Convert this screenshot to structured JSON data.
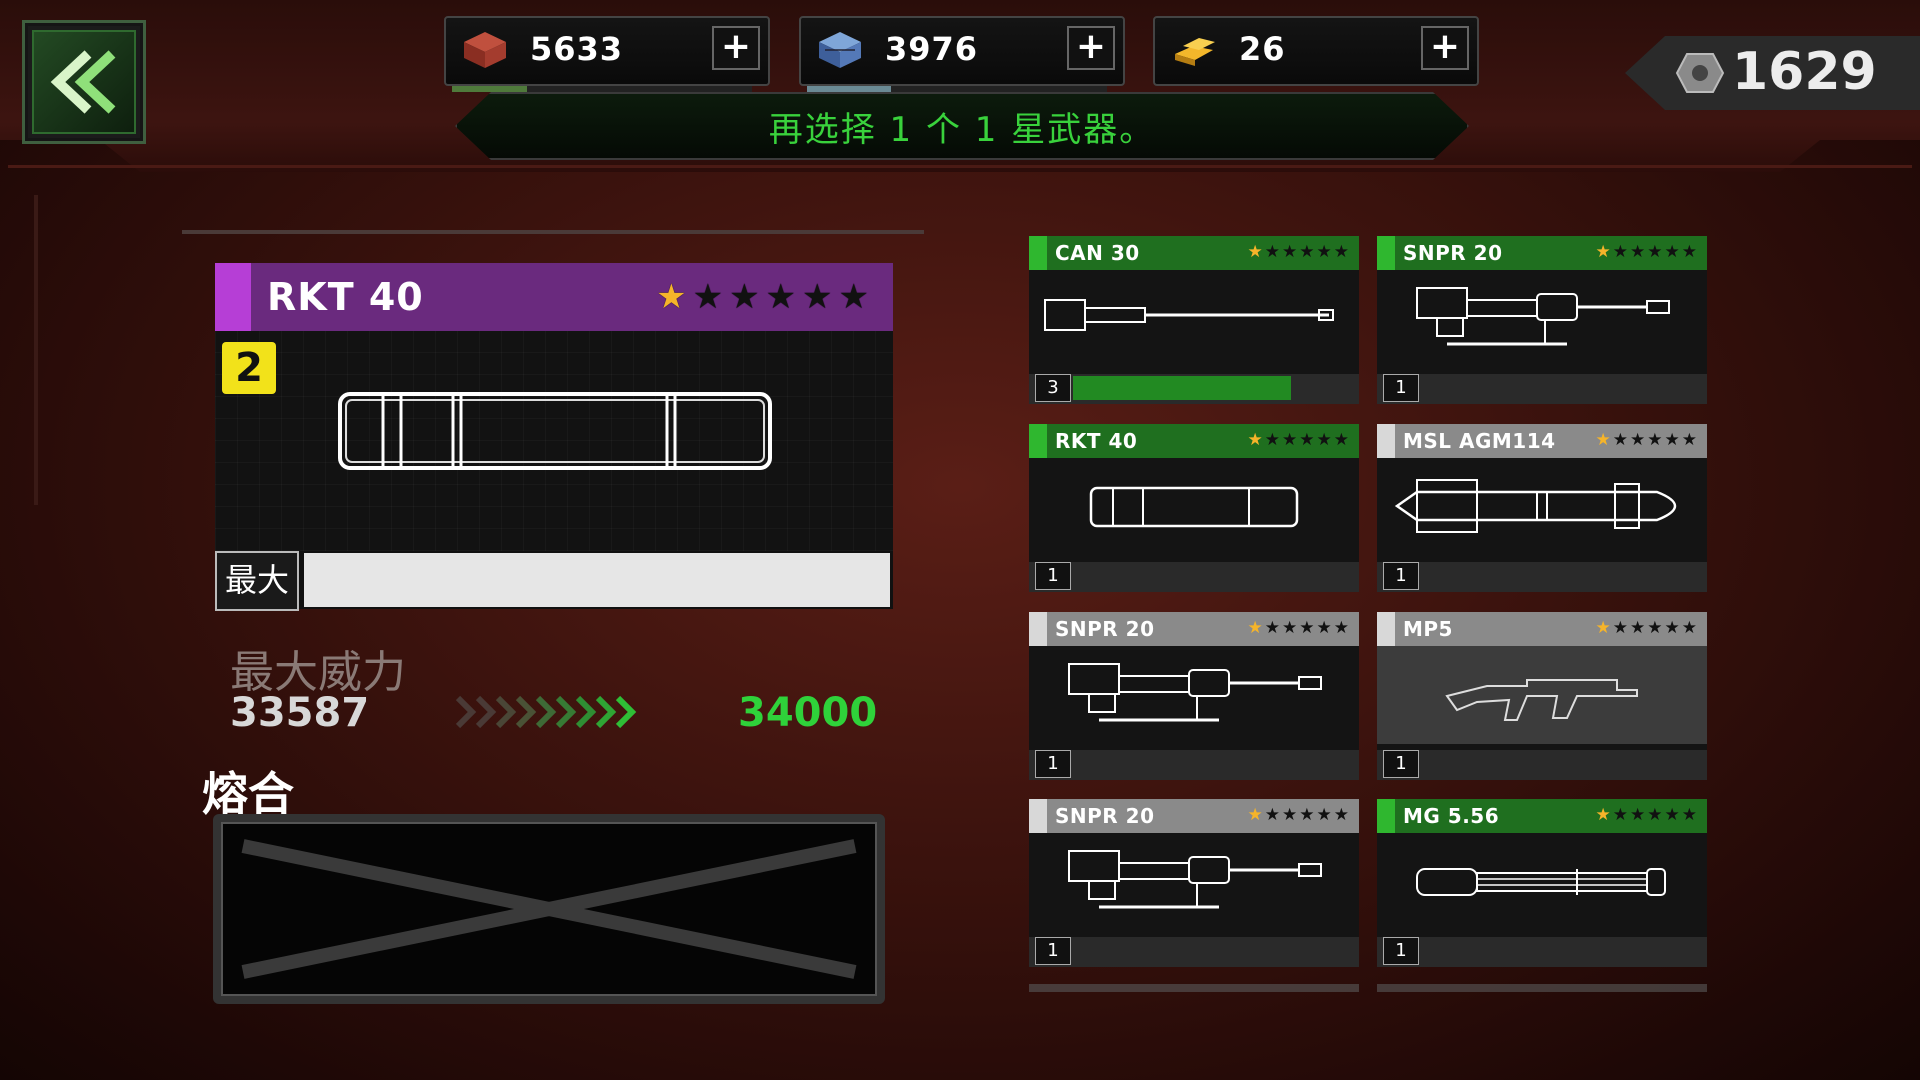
{
  "header": {
    "resources": [
      {
        "name": "red-crate",
        "value": "5633",
        "plus": "+",
        "fill_percent": 25,
        "bar_color": "#4f7a3b"
      },
      {
        "name": "blue-crate",
        "value": "3976",
        "plus": "+",
        "fill_percent": 28,
        "bar_color": "#6a8a94"
      },
      {
        "name": "gold-bars",
        "value": "26",
        "plus": "+",
        "fill_percent": 0,
        "bar_color": "#4f7a3b"
      }
    ],
    "gems": {
      "value": "1629",
      "icon": "hex-nut-icon"
    },
    "banner": "再选择 1 个 1 星武器。"
  },
  "selected": {
    "name": "RKT 40",
    "stars_total": 6,
    "stars_filled": 1,
    "level": "2",
    "max_label": "最大",
    "max_fill_percent": 100,
    "power_label": "最大威力",
    "power_current": "33587",
    "power_next": "34000"
  },
  "fuse": {
    "label": "熔合"
  },
  "weapons": [
    {
      "name": "CAN 30",
      "tier_color": "#2fb72f",
      "head_bg": "#1f6f1f",
      "stars_filled": 1,
      "count": "3",
      "progress_percent": 79,
      "icon": "cannon-icon"
    },
    {
      "name": "SNPR 20",
      "tier_color": "#2fb72f",
      "head_bg": "#1f6f1f",
      "stars_filled": 1,
      "count": "1",
      "progress_percent": 0,
      "icon": "sniper-icon"
    },
    {
      "name": "RKT 40",
      "tier_color": "#2fb72f",
      "head_bg": "#1f6f1f",
      "stars_filled": 1,
      "count": "1",
      "progress_percent": 0,
      "icon": "rocket-pod-icon"
    },
    {
      "name": "MSL AGM114",
      "tier_color": "#d8d8d8",
      "head_bg": "#8a8a8a",
      "stars_filled": 1,
      "count": "1",
      "progress_percent": 0,
      "icon": "missile-icon"
    },
    {
      "name": "SNPR 20",
      "tier_color": "#d8d8d8",
      "head_bg": "#8a8a8a",
      "stars_filled": 1,
      "count": "1",
      "progress_percent": 0,
      "icon": "sniper-icon"
    },
    {
      "name": "MP5",
      "tier_color": "#d8d8d8",
      "head_bg": "#8a8a8a",
      "stars_filled": 1,
      "count": "1",
      "progress_percent": 0,
      "icon": "smg-icon",
      "light": true
    },
    {
      "name": "SNPR 20",
      "tier_color": "#d8d8d8",
      "head_bg": "#8a8a8a",
      "stars_filled": 1,
      "count": "1",
      "progress_percent": 0,
      "icon": "sniper-icon"
    },
    {
      "name": "MG 5.56",
      "tier_color": "#2fb72f",
      "head_bg": "#1f6f1f",
      "stars_filled": 1,
      "count": "1",
      "progress_percent": 0,
      "icon": "minigun-icon"
    }
  ]
}
